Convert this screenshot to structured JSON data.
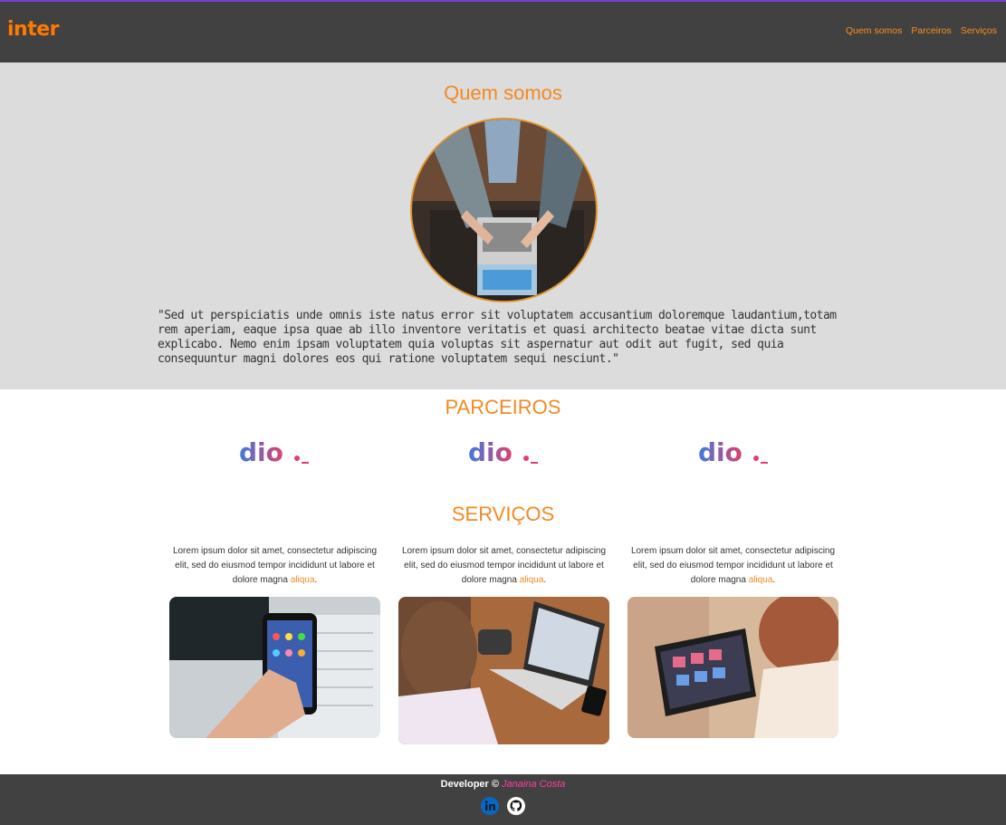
{
  "header": {
    "logo_text": "inter",
    "nav": [
      "Quem somos",
      "Parceiros",
      "Serviços"
    ]
  },
  "about": {
    "title": "Quem somos",
    "text": "\"Sed ut perspiciatis unde omnis iste natus error sit voluptatem accusantium doloremque laudantium,totam rem aperiam, eaque ipsa quae ab illo inventore veritatis et quasi architecto beatae vitae dicta sunt explicabo. Nemo enim ipsam voluptatem quia voluptas sit aspernatur aut odit aut fugit, sed quia consequuntur magni dolores eos qui ratione voluptatem sequi nesciunt.\""
  },
  "partners": {
    "title": "PARCEIROS",
    "logos": [
      "dio._",
      "dio._",
      "dio._"
    ]
  },
  "services": {
    "title": "SERVIÇOS",
    "items": [
      {
        "text": "Lorem ipsum dolor sit amet, consectetur adipiscing elit, sed do eiusmod tempor incididunt ut labore et dolore magna ",
        "highlight": "aliqua",
        "end": "."
      },
      {
        "text": "Lorem ipsum dolor sit amet, consectetur adipiscing elit, sed do eiusmod tempor incididunt ut labore et dolore magna ",
        "highlight": "aliqua",
        "end": "."
      },
      {
        "text": "Lorem ipsum dolor sit amet, consectetur adipiscing elit, sed do eiusmod tempor incididunt ut labore et dolore magna ",
        "highlight": "aliqua",
        "end": "."
      }
    ]
  },
  "footer": {
    "prefix": "Developer © ",
    "name": "Janaina Costa",
    "socials": [
      "linkedin-icon",
      "github-icon"
    ]
  },
  "colors": {
    "accent": "#f28a22",
    "header_bg": "#414141",
    "about_bg": "#dcdcdc",
    "footer_name": "#ff3ea5"
  }
}
